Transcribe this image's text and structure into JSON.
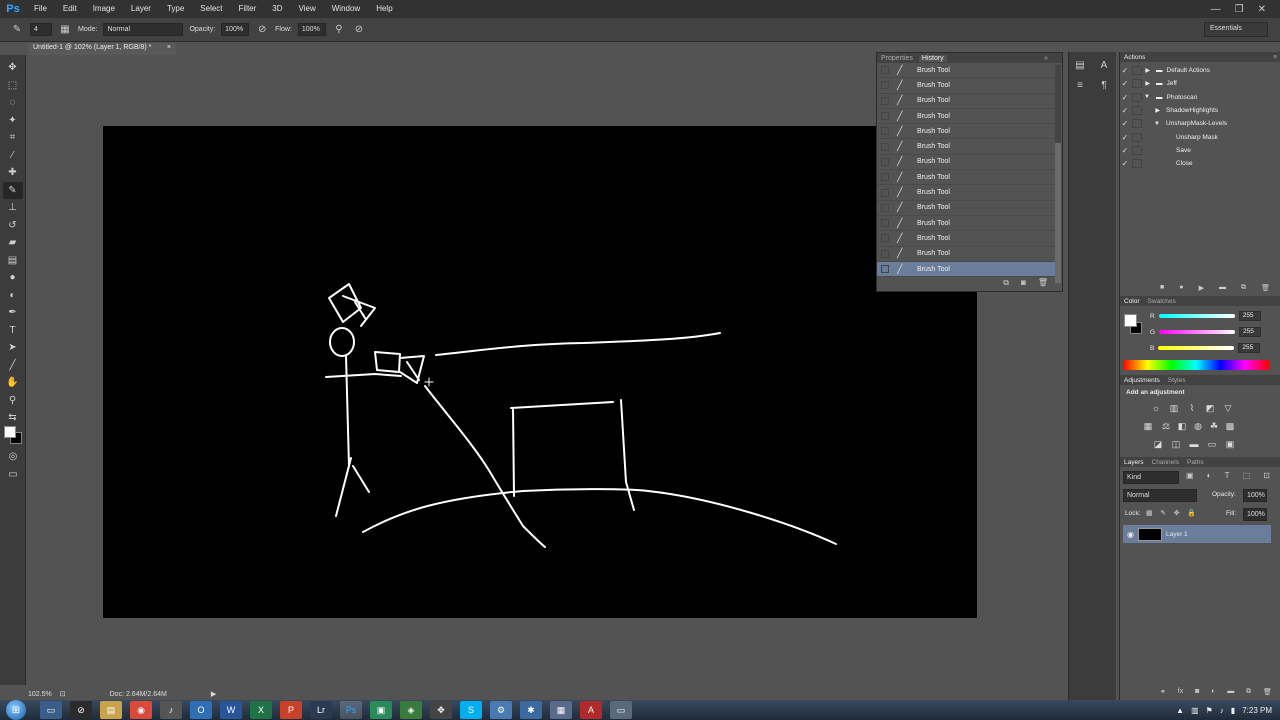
{
  "app": {
    "logo": "Ps"
  },
  "menu": [
    "File",
    "Edit",
    "Image",
    "Layer",
    "Type",
    "Select",
    "Filter",
    "3D",
    "View",
    "Window",
    "Help"
  ],
  "window_controls": [
    "—",
    "❐",
    "✕"
  ],
  "options": {
    "brush_size": "4",
    "mode_label": "Mode:",
    "mode_value": "Normal",
    "opacity_label": "Opacity:",
    "opacity_value": "100%",
    "flow_label": "Flow:",
    "flow_value": "100%"
  },
  "workspace": "Essentials",
  "document": {
    "tab_title": "Untitled-1 @ 102% (Layer 1, RGB/8) *",
    "close": "×"
  },
  "status": {
    "zoom": "102.5%",
    "doc_info": "Doc: 2.64M/2.64M"
  },
  "history": {
    "tabs": [
      "Properties",
      "History"
    ],
    "items": [
      "Brush Tool",
      "Brush Tool",
      "Brush Tool",
      "Brush Tool",
      "Brush Tool",
      "Brush Tool",
      "Brush Tool",
      "Brush Tool",
      "Brush Tool",
      "Brush Tool",
      "Brush Tool",
      "Brush Tool",
      "Brush Tool",
      "Brush Tool"
    ],
    "selected_index": 13
  },
  "actions": {
    "tab": "Actions",
    "items": [
      {
        "label": "Default Actions",
        "level": 0,
        "expanded": false
      },
      {
        "label": "Jeff",
        "level": 0,
        "expanded": false
      },
      {
        "label": "Photoscan",
        "level": 0,
        "expanded": true
      },
      {
        "label": "ShadowHighlights",
        "level": 1,
        "expanded": false
      },
      {
        "label": "UnsharpMask-Levels",
        "level": 1,
        "expanded": true
      },
      {
        "label": "Unsharp Mask",
        "level": 2,
        "expanded": false
      },
      {
        "label": "Save",
        "level": 2,
        "expanded": false
      },
      {
        "label": "Close",
        "level": 2,
        "expanded": false
      }
    ]
  },
  "color": {
    "tabs": [
      "Color",
      "Swatches"
    ],
    "r_label": "R",
    "g_label": "G",
    "b_label": "B",
    "r": "255",
    "g": "255",
    "b": "255",
    "fg": "#ffffff",
    "bg": "#000000"
  },
  "adjustments": {
    "tabs": [
      "Adjustments",
      "Styles"
    ],
    "hint": "Add an adjustment"
  },
  "layers": {
    "tabs": [
      "Layers",
      "Channels",
      "Paths"
    ],
    "kind": "Kind",
    "blend": "Normal",
    "opacity_label": "Opacity:",
    "opacity": "100%",
    "lock_label": "Lock:",
    "fill_label": "Fill:",
    "fill": "100%",
    "layer_name": "Layer 1"
  },
  "taskbar": {
    "clock": "7:23 PM"
  },
  "colors": {
    "accent": "#6a7d9a",
    "canvas": "#000000",
    "brush": "#ffffff"
  }
}
